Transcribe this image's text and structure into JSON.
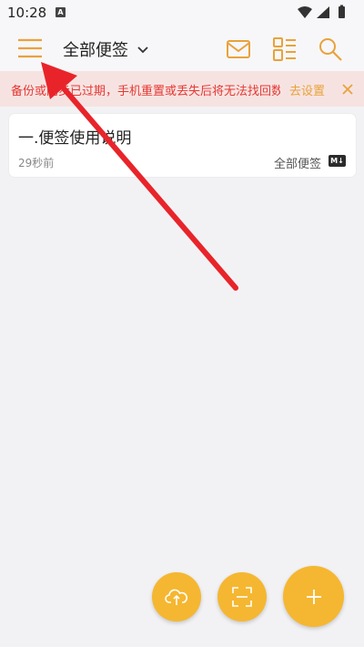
{
  "status_bar": {
    "time": "10:28",
    "notification_icon": "A",
    "icons": [
      "wifi-icon",
      "signal-icon",
      "battery-icon"
    ]
  },
  "app_bar": {
    "folder_title": "全部便签",
    "icons": [
      "menu-icon",
      "chevron-down-icon",
      "mail-icon",
      "layout-icon",
      "search-icon"
    ]
  },
  "banner": {
    "message": "备份或同步已过期，手机重置或丢失后将无法找回数据",
    "action_label": "去设置",
    "close_icon": "close-icon"
  },
  "notes": [
    {
      "title": "一.便签使用说明",
      "time": "29秒前",
      "folder": "全部便签",
      "badge": "M↓"
    }
  ],
  "fabs": [
    "cloud-upload-icon",
    "scan-icon",
    "plus-icon"
  ],
  "colors": {
    "accent": "#f5b731",
    "banner_text": "#e53935",
    "banner_bg": "#f6e3e1",
    "annotation_arrow": "#e8242a"
  }
}
